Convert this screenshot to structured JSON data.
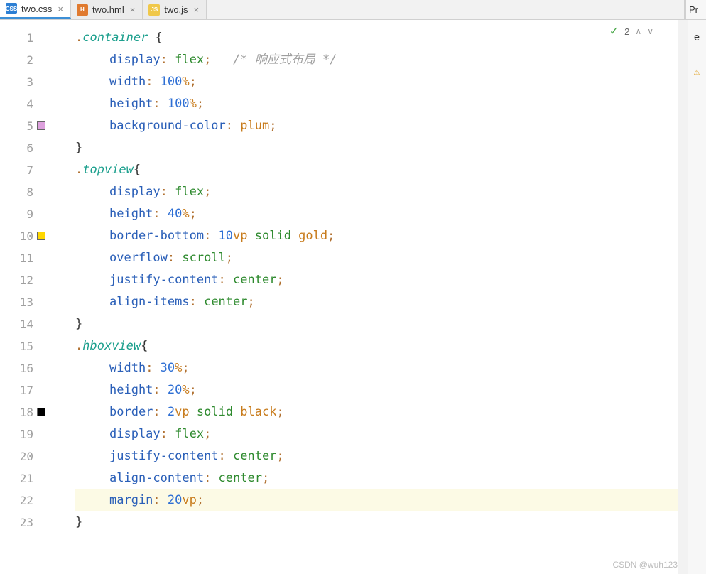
{
  "tabs": [
    {
      "file": "two.css",
      "icon": "CSS",
      "iconClass": "ic-css",
      "active": true
    },
    {
      "file": "two.hml",
      "icon": "H",
      "iconClass": "ic-hml",
      "active": false
    },
    {
      "file": "two.js",
      "icon": "JS",
      "iconClass": "ic-js",
      "active": false
    }
  ],
  "right_panel_title": "Pr",
  "problems": {
    "check_icon": "✓",
    "count": "2",
    "nav_up": "∧",
    "nav_down": "∨"
  },
  "right_markers": {
    "0": "e",
    "1": "⚠"
  },
  "watermark": "CSDN @wuh123",
  "swatches": {
    "5": "sw-plum",
    "10": "sw-gold",
    "18": "sw-black"
  },
  "highlighted_line": 22,
  "lines": {
    "1": {
      "indent": 0,
      "tokens": [
        {
          "c": "tk-punc",
          "t": "."
        },
        {
          "c": "tk-sel",
          "t": "container"
        },
        {
          "c": "",
          "t": " "
        },
        {
          "c": "tk-brace",
          "t": "{"
        }
      ]
    },
    "2": {
      "indent": 1,
      "tokens": [
        {
          "c": "tk-prop",
          "t": "display"
        },
        {
          "c": "tk-punc",
          "t": ": "
        },
        {
          "c": "tk-val",
          "t": "flex"
        },
        {
          "c": "tk-punc",
          "t": ";"
        },
        {
          "c": "",
          "t": "   "
        },
        {
          "c": "tk-cmt",
          "t": "/* 响应式布局 */"
        }
      ]
    },
    "3": {
      "indent": 1,
      "tokens": [
        {
          "c": "tk-prop",
          "t": "width"
        },
        {
          "c": "tk-punc",
          "t": ": "
        },
        {
          "c": "tk-num",
          "t": "100"
        },
        {
          "c": "tk-unit",
          "t": "%"
        },
        {
          "c": "tk-punc",
          "t": ";"
        }
      ]
    },
    "4": {
      "indent": 1,
      "tokens": [
        {
          "c": "tk-prop",
          "t": "height"
        },
        {
          "c": "tk-punc",
          "t": ": "
        },
        {
          "c": "tk-num",
          "t": "100"
        },
        {
          "c": "tk-unit",
          "t": "%"
        },
        {
          "c": "tk-punc",
          "t": ";"
        }
      ]
    },
    "5": {
      "indent": 1,
      "tokens": [
        {
          "c": "tk-prop",
          "t": "background-color"
        },
        {
          "c": "tk-punc",
          "t": ": "
        },
        {
          "c": "tk-color",
          "t": "plum"
        },
        {
          "c": "tk-punc",
          "t": ";"
        }
      ]
    },
    "6": {
      "indent": 0,
      "tokens": [
        {
          "c": "tk-brace",
          "t": "}"
        }
      ]
    },
    "7": {
      "indent": 0,
      "tokens": [
        {
          "c": "tk-punc",
          "t": "."
        },
        {
          "c": "tk-sel",
          "t": "topview"
        },
        {
          "c": "tk-brace",
          "t": "{"
        }
      ]
    },
    "8": {
      "indent": 1,
      "tokens": [
        {
          "c": "tk-prop",
          "t": "display"
        },
        {
          "c": "tk-punc",
          "t": ": "
        },
        {
          "c": "tk-val",
          "t": "flex"
        },
        {
          "c": "tk-punc",
          "t": ";"
        }
      ]
    },
    "9": {
      "indent": 1,
      "tokens": [
        {
          "c": "tk-prop",
          "t": "height"
        },
        {
          "c": "tk-punc",
          "t": ": "
        },
        {
          "c": "tk-num",
          "t": "40"
        },
        {
          "c": "tk-unit",
          "t": "%"
        },
        {
          "c": "tk-punc",
          "t": ";"
        }
      ]
    },
    "10": {
      "indent": 1,
      "tokens": [
        {
          "c": "tk-prop",
          "t": "border-bottom"
        },
        {
          "c": "tk-punc",
          "t": ": "
        },
        {
          "c": "tk-num",
          "t": "10"
        },
        {
          "c": "tk-unit",
          "t": "vp "
        },
        {
          "c": "tk-val",
          "t": "solid "
        },
        {
          "c": "tk-color",
          "t": "gold"
        },
        {
          "c": "tk-punc",
          "t": ";"
        }
      ]
    },
    "11": {
      "indent": 1,
      "tokens": [
        {
          "c": "tk-prop",
          "t": "overflow"
        },
        {
          "c": "tk-punc",
          "t": ": "
        },
        {
          "c": "tk-val",
          "t": "scroll"
        },
        {
          "c": "tk-punc",
          "t": ";"
        }
      ]
    },
    "12": {
      "indent": 1,
      "tokens": [
        {
          "c": "tk-prop",
          "t": "justify-content"
        },
        {
          "c": "tk-punc",
          "t": ": "
        },
        {
          "c": "tk-val",
          "t": "center"
        },
        {
          "c": "tk-punc",
          "t": ";"
        }
      ]
    },
    "13": {
      "indent": 1,
      "tokens": [
        {
          "c": "tk-prop",
          "t": "align-items"
        },
        {
          "c": "tk-punc",
          "t": ": "
        },
        {
          "c": "tk-val",
          "t": "center"
        },
        {
          "c": "tk-punc",
          "t": ";"
        }
      ]
    },
    "14": {
      "indent": 0,
      "tokens": [
        {
          "c": "tk-brace",
          "t": "}"
        }
      ]
    },
    "15": {
      "indent": 0,
      "tokens": [
        {
          "c": "tk-punc",
          "t": "."
        },
        {
          "c": "tk-sel",
          "t": "hboxview"
        },
        {
          "c": "tk-brace",
          "t": "{"
        }
      ]
    },
    "16": {
      "indent": 1,
      "tokens": [
        {
          "c": "tk-prop",
          "t": "width"
        },
        {
          "c": "tk-punc",
          "t": ": "
        },
        {
          "c": "tk-num",
          "t": "30"
        },
        {
          "c": "tk-unit",
          "t": "%"
        },
        {
          "c": "tk-punc",
          "t": ";"
        }
      ]
    },
    "17": {
      "indent": 1,
      "tokens": [
        {
          "c": "tk-prop",
          "t": "height"
        },
        {
          "c": "tk-punc",
          "t": ": "
        },
        {
          "c": "tk-num",
          "t": "20"
        },
        {
          "c": "tk-unit",
          "t": "%"
        },
        {
          "c": "tk-punc",
          "t": ";"
        }
      ]
    },
    "18": {
      "indent": 1,
      "tokens": [
        {
          "c": "tk-prop",
          "t": "border"
        },
        {
          "c": "tk-punc",
          "t": ": "
        },
        {
          "c": "tk-num",
          "t": "2"
        },
        {
          "c": "tk-unit",
          "t": "vp "
        },
        {
          "c": "tk-val",
          "t": "solid "
        },
        {
          "c": "tk-color",
          "t": "black"
        },
        {
          "c": "tk-punc",
          "t": ";"
        }
      ]
    },
    "19": {
      "indent": 1,
      "tokens": [
        {
          "c": "tk-prop",
          "t": "display"
        },
        {
          "c": "tk-punc",
          "t": ": "
        },
        {
          "c": "tk-val",
          "t": "flex"
        },
        {
          "c": "tk-punc",
          "t": ";"
        }
      ]
    },
    "20": {
      "indent": 1,
      "tokens": [
        {
          "c": "tk-prop",
          "t": "justify-content"
        },
        {
          "c": "tk-punc",
          "t": ": "
        },
        {
          "c": "tk-val",
          "t": "center"
        },
        {
          "c": "tk-punc",
          "t": ";"
        }
      ]
    },
    "21": {
      "indent": 1,
      "tokens": [
        {
          "c": "tk-prop",
          "t": "align-content"
        },
        {
          "c": "tk-punc",
          "t": ": "
        },
        {
          "c": "tk-val",
          "t": "center"
        },
        {
          "c": "tk-punc",
          "t": ";"
        }
      ]
    },
    "22": {
      "indent": 1,
      "tokens": [
        {
          "c": "tk-prop",
          "t": "margin"
        },
        {
          "c": "tk-punc",
          "t": ": "
        },
        {
          "c": "tk-num",
          "t": "20"
        },
        {
          "c": "tk-unit",
          "t": "vp"
        },
        {
          "c": "tk-punc",
          "t": ";"
        }
      ],
      "caret": true
    },
    "23": {
      "indent": 0,
      "tokens": [
        {
          "c": "tk-brace",
          "t": "}"
        }
      ]
    }
  }
}
